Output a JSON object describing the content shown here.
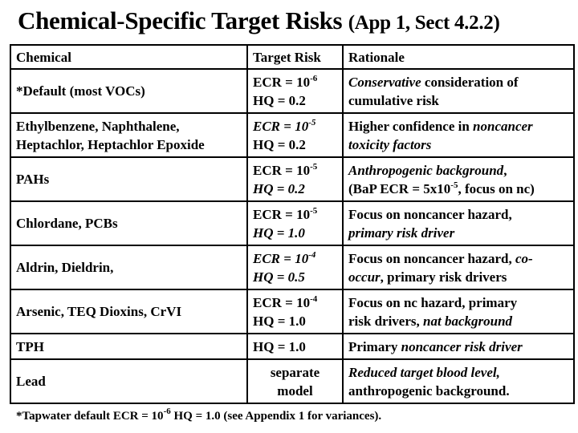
{
  "title": {
    "main": "Chemical-Specific Target Risks",
    "sub": "(App 1, Sect 4.2.2)"
  },
  "table": {
    "headers": [
      "Chemical",
      "Target Risk",
      "Rationale"
    ],
    "rows": [
      {
        "chemical": [
          "*Default (most VOCs)"
        ],
        "ecr": {
          "label": "ECR = 10",
          "exp": "-6",
          "italic": false
        },
        "hq": {
          "text": "HQ = 0.2",
          "italic": false
        },
        "rationale": [
          [
            {
              "t": "Conservative",
              "i": true
            },
            {
              "t": " consideration of",
              "i": false
            }
          ],
          [
            {
              "t": "cumulative risk",
              "i": false
            }
          ]
        ]
      },
      {
        "chemical": [
          "Ethylbenzene, Naphthalene,",
          "Heptachlor, Heptachlor Epoxide"
        ],
        "ecr": {
          "label": "ECR = 10",
          "exp": "-5",
          "italic": true
        },
        "hq": {
          "text": "HQ = 0.2",
          "italic": false
        },
        "rationale": [
          [
            {
              "t": "Higher confidence in ",
              "i": false
            },
            {
              "t": "noncancer",
              "i": true
            }
          ],
          [
            {
              "t": "toxicity factors",
              "i": true
            }
          ]
        ]
      },
      {
        "chemical": [
          "PAHs"
        ],
        "ecr": {
          "label": "ECR = 10",
          "exp": "-5",
          "italic": false
        },
        "hq": {
          "text": "HQ = 0.2",
          "italic": true
        },
        "rationale": [
          [
            {
              "t": "Anthropogenic background",
              "i": true
            },
            {
              "t": ",",
              "i": false
            }
          ],
          [
            {
              "t": "(BaP ECR = 5x10",
              "i": false
            },
            {
              "t": "-5",
              "i": false,
              "sup": true
            },
            {
              "t": ", focus on nc)",
              "i": false
            }
          ]
        ]
      },
      {
        "chemical": [
          "Chlordane, PCBs"
        ],
        "ecr": {
          "label": "ECR = 10",
          "exp": "-5",
          "italic": false
        },
        "hq": {
          "text": "HQ = 1.0",
          "italic": true
        },
        "rationale": [
          [
            {
              "t": "Focus on noncancer hazard,",
              "i": false
            }
          ],
          [
            {
              "t": "primary risk driver",
              "i": true
            }
          ]
        ]
      },
      {
        "chemical": [
          "Aldrin, Dieldrin,"
        ],
        "ecr": {
          "label": "ECR = 10",
          "exp": "-4",
          "italic": true
        },
        "hq": {
          "text": "HQ = 0.5",
          "italic": true
        },
        "rationale": [
          [
            {
              "t": "Focus on noncancer hazard, ",
              "i": false
            },
            {
              "t": "co-",
              "i": true
            }
          ],
          [
            {
              "t": "occur",
              "i": true
            },
            {
              "t": ", primary risk drivers",
              "i": false
            }
          ]
        ]
      },
      {
        "chemical": [
          "Arsenic, TEQ Dioxins, CrVI"
        ],
        "ecr": {
          "label": "ECR = 10",
          "exp": "-4",
          "italic": false
        },
        "hq": {
          "text": "HQ = 1.0",
          "italic": false
        },
        "rationale": [
          [
            {
              "t": "Focus on nc hazard, primary",
              "i": false
            }
          ],
          [
            {
              "t": "risk drivers, ",
              "i": false
            },
            {
              "t": "nat background",
              "i": true
            }
          ]
        ]
      },
      {
        "chemical": [
          "TPH"
        ],
        "ecr": null,
        "hq": {
          "text": "HQ = 1.0",
          "italic": false
        },
        "rationale": [
          [
            {
              "t": "Primary ",
              "i": false
            },
            {
              "t": "noncancer risk driver",
              "i": true
            }
          ]
        ]
      },
      {
        "chemical": [
          "Lead"
        ],
        "ecr": null,
        "hq": null,
        "target_text": [
          "separate",
          "model"
        ],
        "rationale": [
          [
            {
              "t": "Reduced target blood level,",
              "i": true
            }
          ],
          [
            {
              "t": "anthropogenic background.",
              "i": false
            }
          ]
        ]
      }
    ]
  },
  "footnote": {
    "before": "*Tapwater default ECR = 10",
    "exp": "-6",
    "after": " HQ = 1.0 (see Appendix 1 for variances)."
  }
}
